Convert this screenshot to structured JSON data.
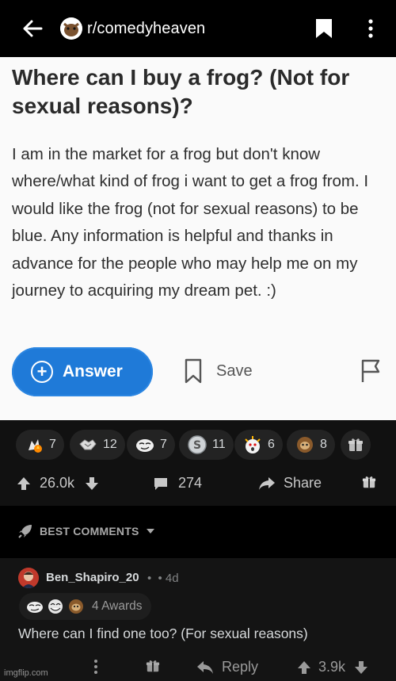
{
  "header": {
    "subreddit": "r/comedyheaven",
    "back_icon": "arrow-left-icon",
    "save_icon": "bookmark-icon",
    "more_icon": "kebab-icon"
  },
  "question": {
    "title": "Where can I buy a frog? (Not for sexual reasons)?",
    "body": "I am in the market for a frog but don't know where/what kind of frog i want to get a frog from. I would like the frog (not for sexual reasons) to be blue. Any information is helpful and thanks in advance for the people who may help me on my journey to acquiring my dream pet. :)",
    "answer_label": "Answer",
    "save_label": "Save"
  },
  "awards": [
    {
      "icon": "fire-hand-award-icon",
      "count": "7"
    },
    {
      "icon": "handshake-award-icon",
      "count": "12"
    },
    {
      "icon": "face-award-icon",
      "count": "7"
    },
    {
      "icon": "silver-award-icon",
      "count": "11"
    },
    {
      "icon": "wow-award-icon",
      "count": "6"
    },
    {
      "icon": "sloth-award-icon",
      "count": "8"
    }
  ],
  "post_actions": {
    "score": "26.0k",
    "comments": "274",
    "share_label": "Share"
  },
  "best_comments_label": "BEST COMMENTS",
  "comment": {
    "username": "Ben_Shapiro_20",
    "separator": "•",
    "time": "• 4d",
    "awards_label": "4 Awards",
    "text": "Where can I find one too? (For sexual reasons)",
    "reply_label": "Reply",
    "score": "3.9k"
  },
  "watermark": "imgflip.com",
  "colors": {
    "answer_blue": "#1f7ad8",
    "background": "#0b0b0b",
    "card": "#fafafa"
  }
}
